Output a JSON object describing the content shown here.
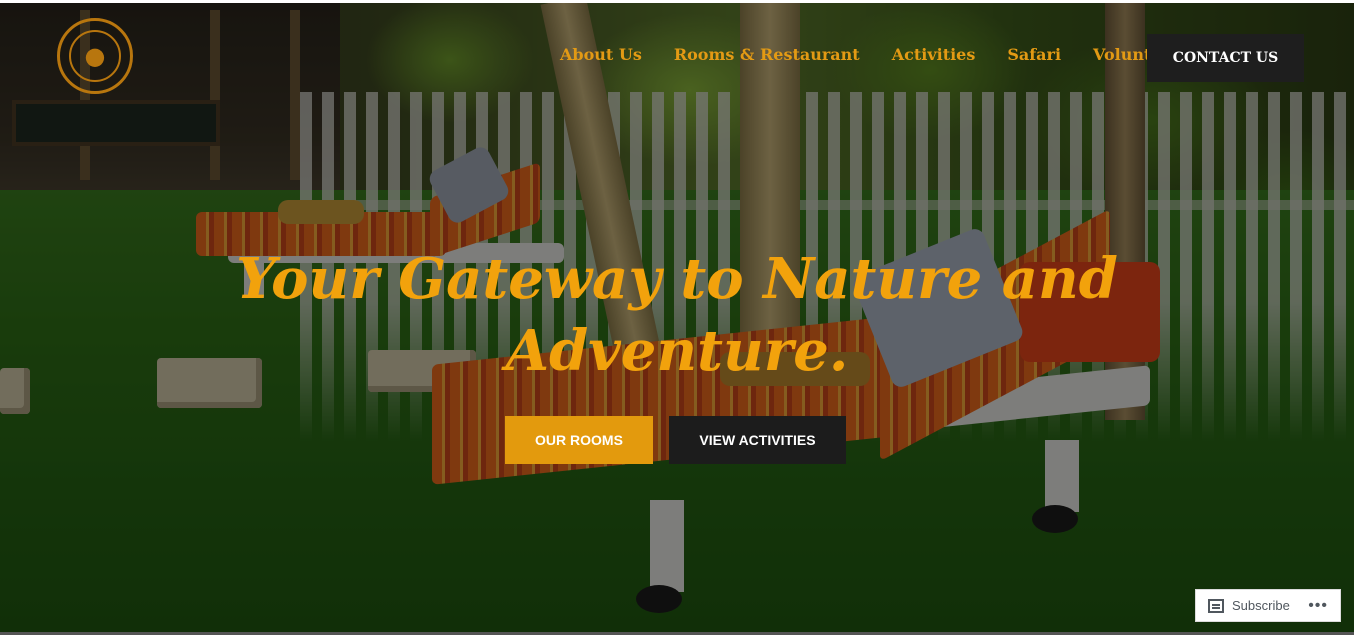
{
  "header": {
    "nav": [
      {
        "label": "About Us"
      },
      {
        "label": "Rooms & Restaurant"
      },
      {
        "label": "Activities"
      },
      {
        "label": "Safari"
      },
      {
        "label": "Volunteer"
      }
    ],
    "contact_label": "CONTACT US",
    "accent_color": "#e39a14"
  },
  "hero": {
    "headline_line1": "Your Gateway to Nature and",
    "headline_line2": "Adventure.",
    "primary_button": "OUR ROOMS",
    "secondary_button": "VIEW ACTIVITIES",
    "primary_color": "#e39a0d",
    "secondary_color": "#1c1c1c"
  },
  "subscribe": {
    "label": "Subscribe",
    "more_icon": "ellipsis-icon"
  }
}
